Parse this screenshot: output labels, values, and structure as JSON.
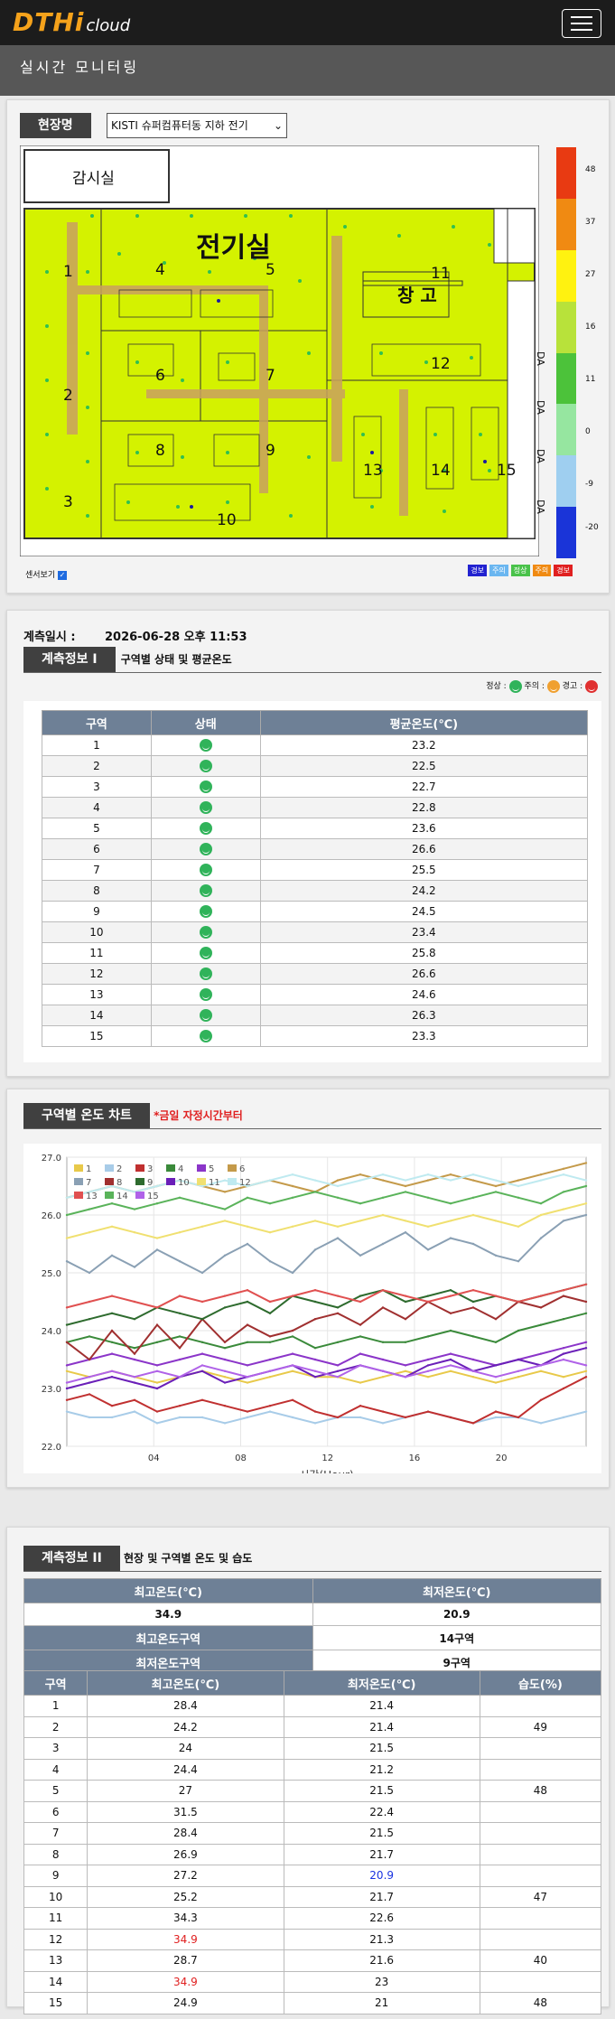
{
  "brand": {
    "logo_main": "DTHi",
    "logo_sub": "cloud"
  },
  "header": {
    "title": "실시간  모니터링"
  },
  "site": {
    "label": "현장명",
    "selected": "KISTI 슈퍼컴퓨터동 지하 전기"
  },
  "map": {
    "rooms": {
      "monitor": "감시실",
      "electric": "전기실",
      "storage": "창 고"
    },
    "zones": [
      "1",
      "2",
      "3",
      "4",
      "5",
      "6",
      "7",
      "8",
      "9",
      "10",
      "11",
      "12",
      "13",
      "14",
      "15"
    ],
    "side_labels": [
      "DA",
      "DA",
      "DA",
      "DA"
    ],
    "legend": [
      "48",
      "37",
      "27",
      "16",
      "11",
      "0",
      "-9",
      "-20"
    ],
    "sensor_label": "센서보기",
    "status_chips": [
      "경보",
      "주의",
      "정상",
      "주의",
      "경보"
    ]
  },
  "measure": {
    "label": "계측일시 :",
    "datetime": "2026-06-28 오후 11:53"
  },
  "info1": {
    "tag": "계측정보 I",
    "title": "구역별 상태 및 평균온도",
    "status_legend": {
      "normal": "정상 :",
      "caution": "주의 :",
      "warning": "경고 :"
    },
    "headers": [
      "구역",
      "상태",
      "평균온도(℃)"
    ],
    "rows": [
      [
        "1",
        "23.2"
      ],
      [
        "2",
        "22.5"
      ],
      [
        "3",
        "22.7"
      ],
      [
        "4",
        "22.8"
      ],
      [
        "5",
        "23.6"
      ],
      [
        "6",
        "26.6"
      ],
      [
        "7",
        "25.5"
      ],
      [
        "8",
        "24.2"
      ],
      [
        "9",
        "24.5"
      ],
      [
        "10",
        "23.4"
      ],
      [
        "11",
        "25.8"
      ],
      [
        "12",
        "26.6"
      ],
      [
        "13",
        "24.6"
      ],
      [
        "14",
        "26.3"
      ],
      [
        "15",
        "23.3"
      ]
    ]
  },
  "chart": {
    "tag": "구역별 온도 차트",
    "note": "*금일 자정시간부터"
  },
  "chart_data": {
    "type": "line",
    "xlabel": "시간(Hour)",
    "ylabel": "",
    "ylim": [
      22.0,
      27.0
    ],
    "xlim": [
      0,
      23.9
    ],
    "x_ticks": [
      "04",
      "08",
      "12",
      "16",
      "20"
    ],
    "y_ticks": [
      "27.0",
      "26.0",
      "25.0",
      "24.0",
      "23.0",
      "22.0"
    ],
    "series": [
      {
        "name": "1",
        "color": "#e8c94a",
        "values": [
          23.3,
          23.2,
          23.3,
          23.2,
          23.1,
          23.2,
          23.3,
          23.2,
          23.1,
          23.2,
          23.3,
          23.2,
          23.2,
          23.1,
          23.2,
          23.3,
          23.2,
          23.3,
          23.2,
          23.1,
          23.2,
          23.3,
          23.2,
          23.3
        ]
      },
      {
        "name": "2",
        "color": "#a8cce8",
        "values": [
          22.6,
          22.5,
          22.5,
          22.6,
          22.4,
          22.5,
          22.5,
          22.4,
          22.5,
          22.6,
          22.5,
          22.4,
          22.5,
          22.5,
          22.4,
          22.5,
          22.6,
          22.5,
          22.4,
          22.5,
          22.5,
          22.4,
          22.5,
          22.6
        ]
      },
      {
        "name": "3",
        "color": "#c03030",
        "values": [
          22.8,
          22.9,
          22.7,
          22.8,
          22.6,
          22.7,
          22.8,
          22.7,
          22.6,
          22.7,
          22.8,
          22.6,
          22.5,
          22.7,
          22.6,
          22.5,
          22.6,
          22.5,
          22.4,
          22.6,
          22.5,
          22.8,
          23.0,
          23.2
        ]
      },
      {
        "name": "4",
        "color": "#3a8a3a",
        "values": [
          23.8,
          23.9,
          23.8,
          23.7,
          23.8,
          23.9,
          23.8,
          23.7,
          23.8,
          23.8,
          23.9,
          23.7,
          23.8,
          23.9,
          23.8,
          23.8,
          23.9,
          24.0,
          23.9,
          23.8,
          24.0,
          24.1,
          24.2,
          24.3
        ]
      },
      {
        "name": "5",
        "color": "#8b35c9",
        "values": [
          23.4,
          23.5,
          23.6,
          23.5,
          23.4,
          23.5,
          23.6,
          23.5,
          23.4,
          23.5,
          23.6,
          23.5,
          23.4,
          23.6,
          23.5,
          23.4,
          23.5,
          23.6,
          23.5,
          23.4,
          23.5,
          23.6,
          23.7,
          23.8
        ]
      },
      {
        "name": "6",
        "color": "#c49a4a",
        "values": [
          26.3,
          26.4,
          26.5,
          26.4,
          26.5,
          26.6,
          26.5,
          26.4,
          26.5,
          26.6,
          26.5,
          26.4,
          26.6,
          26.7,
          26.6,
          26.5,
          26.6,
          26.7,
          26.6,
          26.5,
          26.6,
          26.7,
          26.8,
          26.9
        ]
      },
      {
        "name": "7",
        "color": "#8aa0b4",
        "values": [
          25.2,
          25.0,
          25.3,
          25.1,
          25.4,
          25.2,
          25.0,
          25.3,
          25.5,
          25.2,
          25.0,
          25.4,
          25.6,
          25.3,
          25.5,
          25.7,
          25.4,
          25.6,
          25.5,
          25.3,
          25.2,
          25.6,
          25.9,
          26.0
        ]
      },
      {
        "name": "8",
        "color": "#a03030",
        "values": [
          23.8,
          23.5,
          24.0,
          23.6,
          24.1,
          23.7,
          24.2,
          23.8,
          24.1,
          23.9,
          24.0,
          24.2,
          24.3,
          24.1,
          24.4,
          24.2,
          24.5,
          24.3,
          24.4,
          24.2,
          24.5,
          24.4,
          24.6,
          24.5
        ]
      },
      {
        "name": "9",
        "color": "#2e6b2e",
        "values": [
          24.1,
          24.2,
          24.3,
          24.2,
          24.4,
          24.3,
          24.2,
          24.4,
          24.5,
          24.3,
          24.6,
          24.5,
          24.4,
          24.6,
          24.7,
          24.5,
          24.6,
          24.7,
          24.5,
          24.6,
          24.5,
          24.6,
          24.7,
          24.8
        ]
      },
      {
        "name": "10",
        "color": "#6a1fb8",
        "values": [
          23.0,
          23.1,
          23.2,
          23.1,
          23.0,
          23.2,
          23.3,
          23.1,
          23.2,
          23.3,
          23.4,
          23.2,
          23.3,
          23.4,
          23.3,
          23.2,
          23.4,
          23.5,
          23.3,
          23.4,
          23.5,
          23.4,
          23.6,
          23.7
        ]
      },
      {
        "name": "11",
        "color": "#f0e070",
        "values": [
          25.6,
          25.7,
          25.8,
          25.7,
          25.6,
          25.7,
          25.8,
          25.9,
          25.8,
          25.7,
          25.8,
          25.9,
          25.8,
          25.9,
          26.0,
          25.9,
          25.8,
          25.9,
          26.0,
          25.9,
          25.8,
          26.0,
          26.1,
          26.2
        ]
      },
      {
        "name": "12",
        "color": "#bfeaf0",
        "values": [
          26.3,
          26.4,
          26.5,
          26.4,
          26.5,
          26.6,
          26.5,
          26.6,
          26.5,
          26.6,
          26.7,
          26.6,
          26.5,
          26.6,
          26.7,
          26.6,
          26.7,
          26.6,
          26.7,
          26.6,
          26.5,
          26.6,
          26.7,
          26.6
        ]
      },
      {
        "name": "13",
        "color": "#e05050",
        "values": [
          24.4,
          24.5,
          24.6,
          24.5,
          24.4,
          24.6,
          24.5,
          24.6,
          24.7,
          24.5,
          24.6,
          24.7,
          24.6,
          24.5,
          24.7,
          24.6,
          24.5,
          24.6,
          24.7,
          24.6,
          24.5,
          24.6,
          24.7,
          24.8
        ]
      },
      {
        "name": "14",
        "color": "#5ab35a",
        "values": [
          26.0,
          26.1,
          26.2,
          26.1,
          26.2,
          26.3,
          26.2,
          26.1,
          26.3,
          26.2,
          26.3,
          26.4,
          26.3,
          26.2,
          26.3,
          26.4,
          26.3,
          26.2,
          26.3,
          26.4,
          26.3,
          26.2,
          26.4,
          26.5
        ]
      },
      {
        "name": "15",
        "color": "#b062e8",
        "values": [
          23.1,
          23.2,
          23.3,
          23.2,
          23.3,
          23.2,
          23.4,
          23.3,
          23.2,
          23.3,
          23.4,
          23.3,
          23.2,
          23.4,
          23.3,
          23.2,
          23.3,
          23.4,
          23.3,
          23.2,
          23.3,
          23.4,
          23.5,
          23.4
        ]
      }
    ]
  },
  "info2": {
    "tag": "계측정보 II",
    "title": "현장 및 구역별 온도 및 습도",
    "summary_headers": [
      "최고온도(℃)",
      "최저온도(℃)"
    ],
    "summary_values": [
      "34.9",
      "20.9"
    ],
    "max_zone_label": "최고온도구역",
    "max_zone_value": "14구역",
    "min_zone_label": "최저온도구역",
    "min_zone_value": "9구역",
    "headers": [
      "구역",
      "최고온도(℃)",
      "최저온도(℃)",
      "습도(%)"
    ],
    "rows": [
      [
        "1",
        "28.4",
        "21.4",
        ""
      ],
      [
        "2",
        "24.2",
        "21.4",
        "49"
      ],
      [
        "3",
        "24",
        "21.5",
        ""
      ],
      [
        "4",
        "24.4",
        "21.2",
        ""
      ],
      [
        "5",
        "27",
        "21.5",
        "48"
      ],
      [
        "6",
        "31.5",
        "22.4",
        ""
      ],
      [
        "7",
        "28.4",
        "21.5",
        ""
      ],
      [
        "8",
        "26.9",
        "21.7",
        ""
      ],
      [
        "9",
        "27.2",
        "20.9",
        ""
      ],
      [
        "10",
        "25.2",
        "21.7",
        "47"
      ],
      [
        "11",
        "34.3",
        "22.6",
        ""
      ],
      [
        "12",
        "34.9",
        "21.3",
        ""
      ],
      [
        "13",
        "28.7",
        "21.6",
        "40"
      ],
      [
        "14",
        "34.9",
        "23",
        ""
      ],
      [
        "15",
        "24.9",
        "21",
        "48"
      ]
    ],
    "highlight": {
      "max": "#e02020",
      "min": "#1a33e0"
    }
  }
}
